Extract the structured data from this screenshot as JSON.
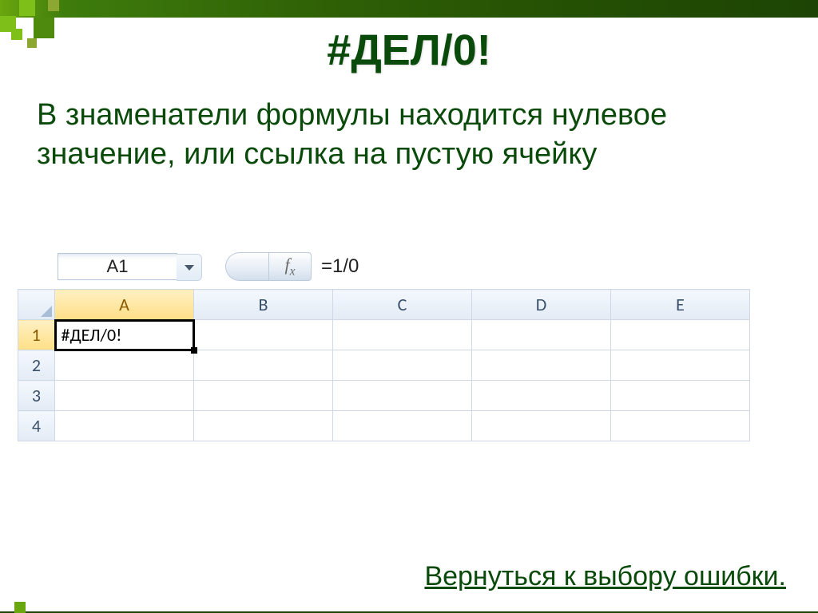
{
  "slide": {
    "title": "#ДЕЛ/0!",
    "body": "В знаменатели формулы находится нулевое значение, или ссылка на пустую ячейку",
    "back_link": "Вернуться к выбору ошибки."
  },
  "excel": {
    "namebox_value": "A1",
    "fx_label": "fx",
    "formula": "=1/0",
    "columns": [
      "A",
      "B",
      "C",
      "D",
      "E"
    ],
    "rows": [
      "1",
      "2",
      "3",
      "4"
    ],
    "active_cell_value": "#ДЕЛ/0!"
  }
}
